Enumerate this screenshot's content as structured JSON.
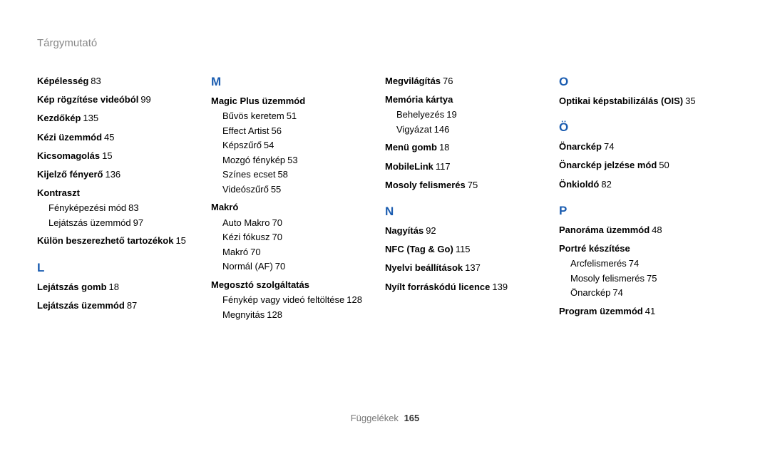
{
  "title": "Tárgymutató",
  "footer": {
    "label": "Függelékek",
    "page": "165"
  },
  "col1": {
    "entries": [
      {
        "label": "Képélesség",
        "page": "83"
      },
      {
        "label": "Kép rögzítése videóból",
        "page": "99"
      },
      {
        "label": "Kezdőkép",
        "page": "135"
      },
      {
        "label": "Kézi üzemmód",
        "page": "45"
      },
      {
        "label": "Kicsomagolás",
        "page": "15"
      },
      {
        "label": "Kijelző fényerő",
        "page": "136"
      }
    ],
    "kontraszt": {
      "label": "Kontraszt",
      "subs": [
        {
          "label": "Fényképezési mód",
          "page": "83"
        },
        {
          "label": "Lejátszás üzemmód",
          "page": "97"
        }
      ]
    },
    "kulon": {
      "label": "Külön beszerezhető tartozékok",
      "page": "15"
    },
    "letter_l": "L",
    "l_entries": [
      {
        "label": "Lejátszás gomb",
        "page": "18"
      },
      {
        "label": "Lejátszás üzemmód",
        "page": "87"
      }
    ]
  },
  "col2": {
    "letter_m": "M",
    "magic": {
      "label": "Magic Plus üzemmód",
      "subs": [
        {
          "label": "Bűvös keretem",
          "page": "51"
        },
        {
          "label": "Effect Artist",
          "page": "56"
        },
        {
          "label": "Képszűrő",
          "page": "54"
        },
        {
          "label": "Mozgó fénykép",
          "page": "53"
        },
        {
          "label": "Színes ecset",
          "page": "58"
        },
        {
          "label": "Videószűrő",
          "page": "55"
        }
      ]
    },
    "makro": {
      "label": "Makró",
      "subs": [
        {
          "label": "Auto Makro",
          "page": "70"
        },
        {
          "label": "Kézi fókusz",
          "page": "70"
        },
        {
          "label": "Makró",
          "page": "70"
        },
        {
          "label": "Normál (AF)",
          "page": "70"
        }
      ]
    },
    "megoszto": {
      "label": "Megosztó szolgáltatás",
      "subs": [
        {
          "label": "Fénykép vagy videó feltöltése",
          "page": "128"
        },
        {
          "label": "Megnyitás",
          "page": "128"
        }
      ]
    }
  },
  "col3": {
    "megvil": {
      "label": "Megvilágítás",
      "page": "76"
    },
    "memoria": {
      "label": "Memória kártya",
      "subs": [
        {
          "label": "Behelyezés",
          "page": "19"
        },
        {
          "label": "Vigyázat",
          "page": "146"
        }
      ]
    },
    "m_rest": [
      {
        "label": "Menü gomb",
        "page": "18"
      },
      {
        "label": "MobileLink",
        "page": "117"
      },
      {
        "label": "Mosoly felismerés",
        "page": "75"
      }
    ],
    "letter_n": "N",
    "n_entries": [
      {
        "label": "Nagyítás",
        "page": "92"
      },
      {
        "label": "NFC (Tag & Go)",
        "page": "115"
      },
      {
        "label": "Nyelvi beállítások",
        "page": "137"
      },
      {
        "label": "Nyílt forráskódú licence",
        "page": "139"
      }
    ]
  },
  "col4": {
    "letter_o": "O",
    "o_entries": [
      {
        "label": "Optikai képstabilizálás (OIS)",
        "page": "35"
      }
    ],
    "letter_o2": "Ö",
    "o2_entries": [
      {
        "label": "Önarckép",
        "page": "74"
      },
      {
        "label": "Önarckép jelzése mód",
        "page": "50"
      },
      {
        "label": "Önkioldó",
        "page": "82"
      }
    ],
    "letter_p": "P",
    "panorama": {
      "label": "Panoráma üzemmód",
      "page": "48"
    },
    "portre": {
      "label": "Portré készítése",
      "subs": [
        {
          "label": "Arcfelismerés",
          "page": "74"
        },
        {
          "label": "Mosoly felismerés",
          "page": "75"
        },
        {
          "label": "Önarckép",
          "page": "74"
        }
      ]
    },
    "program": {
      "label": "Program üzemmód",
      "page": "41"
    }
  }
}
